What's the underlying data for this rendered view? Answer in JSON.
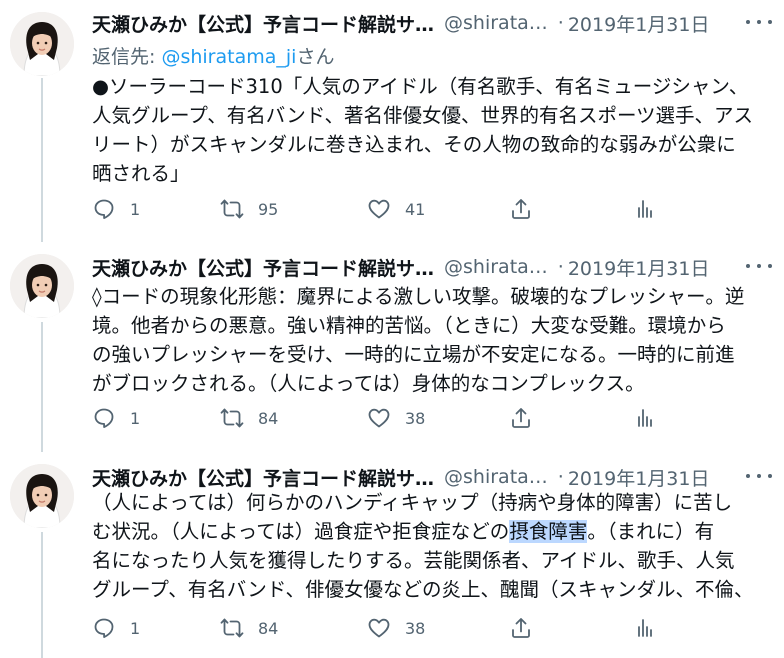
{
  "tweets": [
    {
      "name": "天瀬ひみか【公式】予言コード解説サ…",
      "handle": "@shirata…",
      "dot": "·",
      "date": "2019年1月31日",
      "reply_prefix": "返信先: ",
      "reply_handle": "@shiratama_ji",
      "reply_suffix": "さん",
      "lines": [
        "●ソーラーコード310「人気のアイドル（有名歌手、有名ミュージシャン、",
        "人気グループ、有名バンド、著名俳優女優、世界的有名スポーツ選手、アス",
        "リート）がスキャンダルに巻き込まれ、その人物の致命的な弱みが公衆に",
        "晒される」"
      ],
      "replies": "1",
      "retweets": "95",
      "likes": "41"
    },
    {
      "name": "天瀬ひみか【公式】予言コード解説サ…",
      "handle": "@shirata…",
      "dot": "·",
      "date": "2019年1月31日",
      "lines": [
        "◊コードの現象化形態：魔界による激しい攻撃。破壊的なプレッシャー。逆",
        "境。他者からの悪意。強い精神的苦悩。（ときに）大変な受難。環境から",
        "の強いプレッシャーを受け、一時的に立場が不安定になる。一時的に前進",
        "がブロックされる。（人によっては）身体的なコンプレックス。"
      ],
      "replies": "1",
      "retweets": "84",
      "likes": "38"
    },
    {
      "name": "天瀬ひみか【公式】予言コード解説サ…",
      "handle": "@shirata…",
      "dot": "·",
      "date": "2019年1月31日",
      "lines": [
        "（人によっては）何らかのハンディキャップ（持病や身体的障害）に苦し",
        "む状況。（人によっては）過食症や拒食症などの",
        "名になったり人気を獲得したりする。芸能関係者、アイドル、歌手、人気",
        "グループ、有名バンド、俳優女優などの炎上、醜聞（スキャンダル、不倫、"
      ],
      "highlight": "摂食障害",
      "line2_tail": "。（まれに）有",
      "replies": "1",
      "retweets": "84",
      "likes": "38"
    }
  ],
  "icons": [
    "reply-icon",
    "retweet-icon",
    "like-icon",
    "share-icon",
    "analytics-icon",
    "more-icon"
  ]
}
